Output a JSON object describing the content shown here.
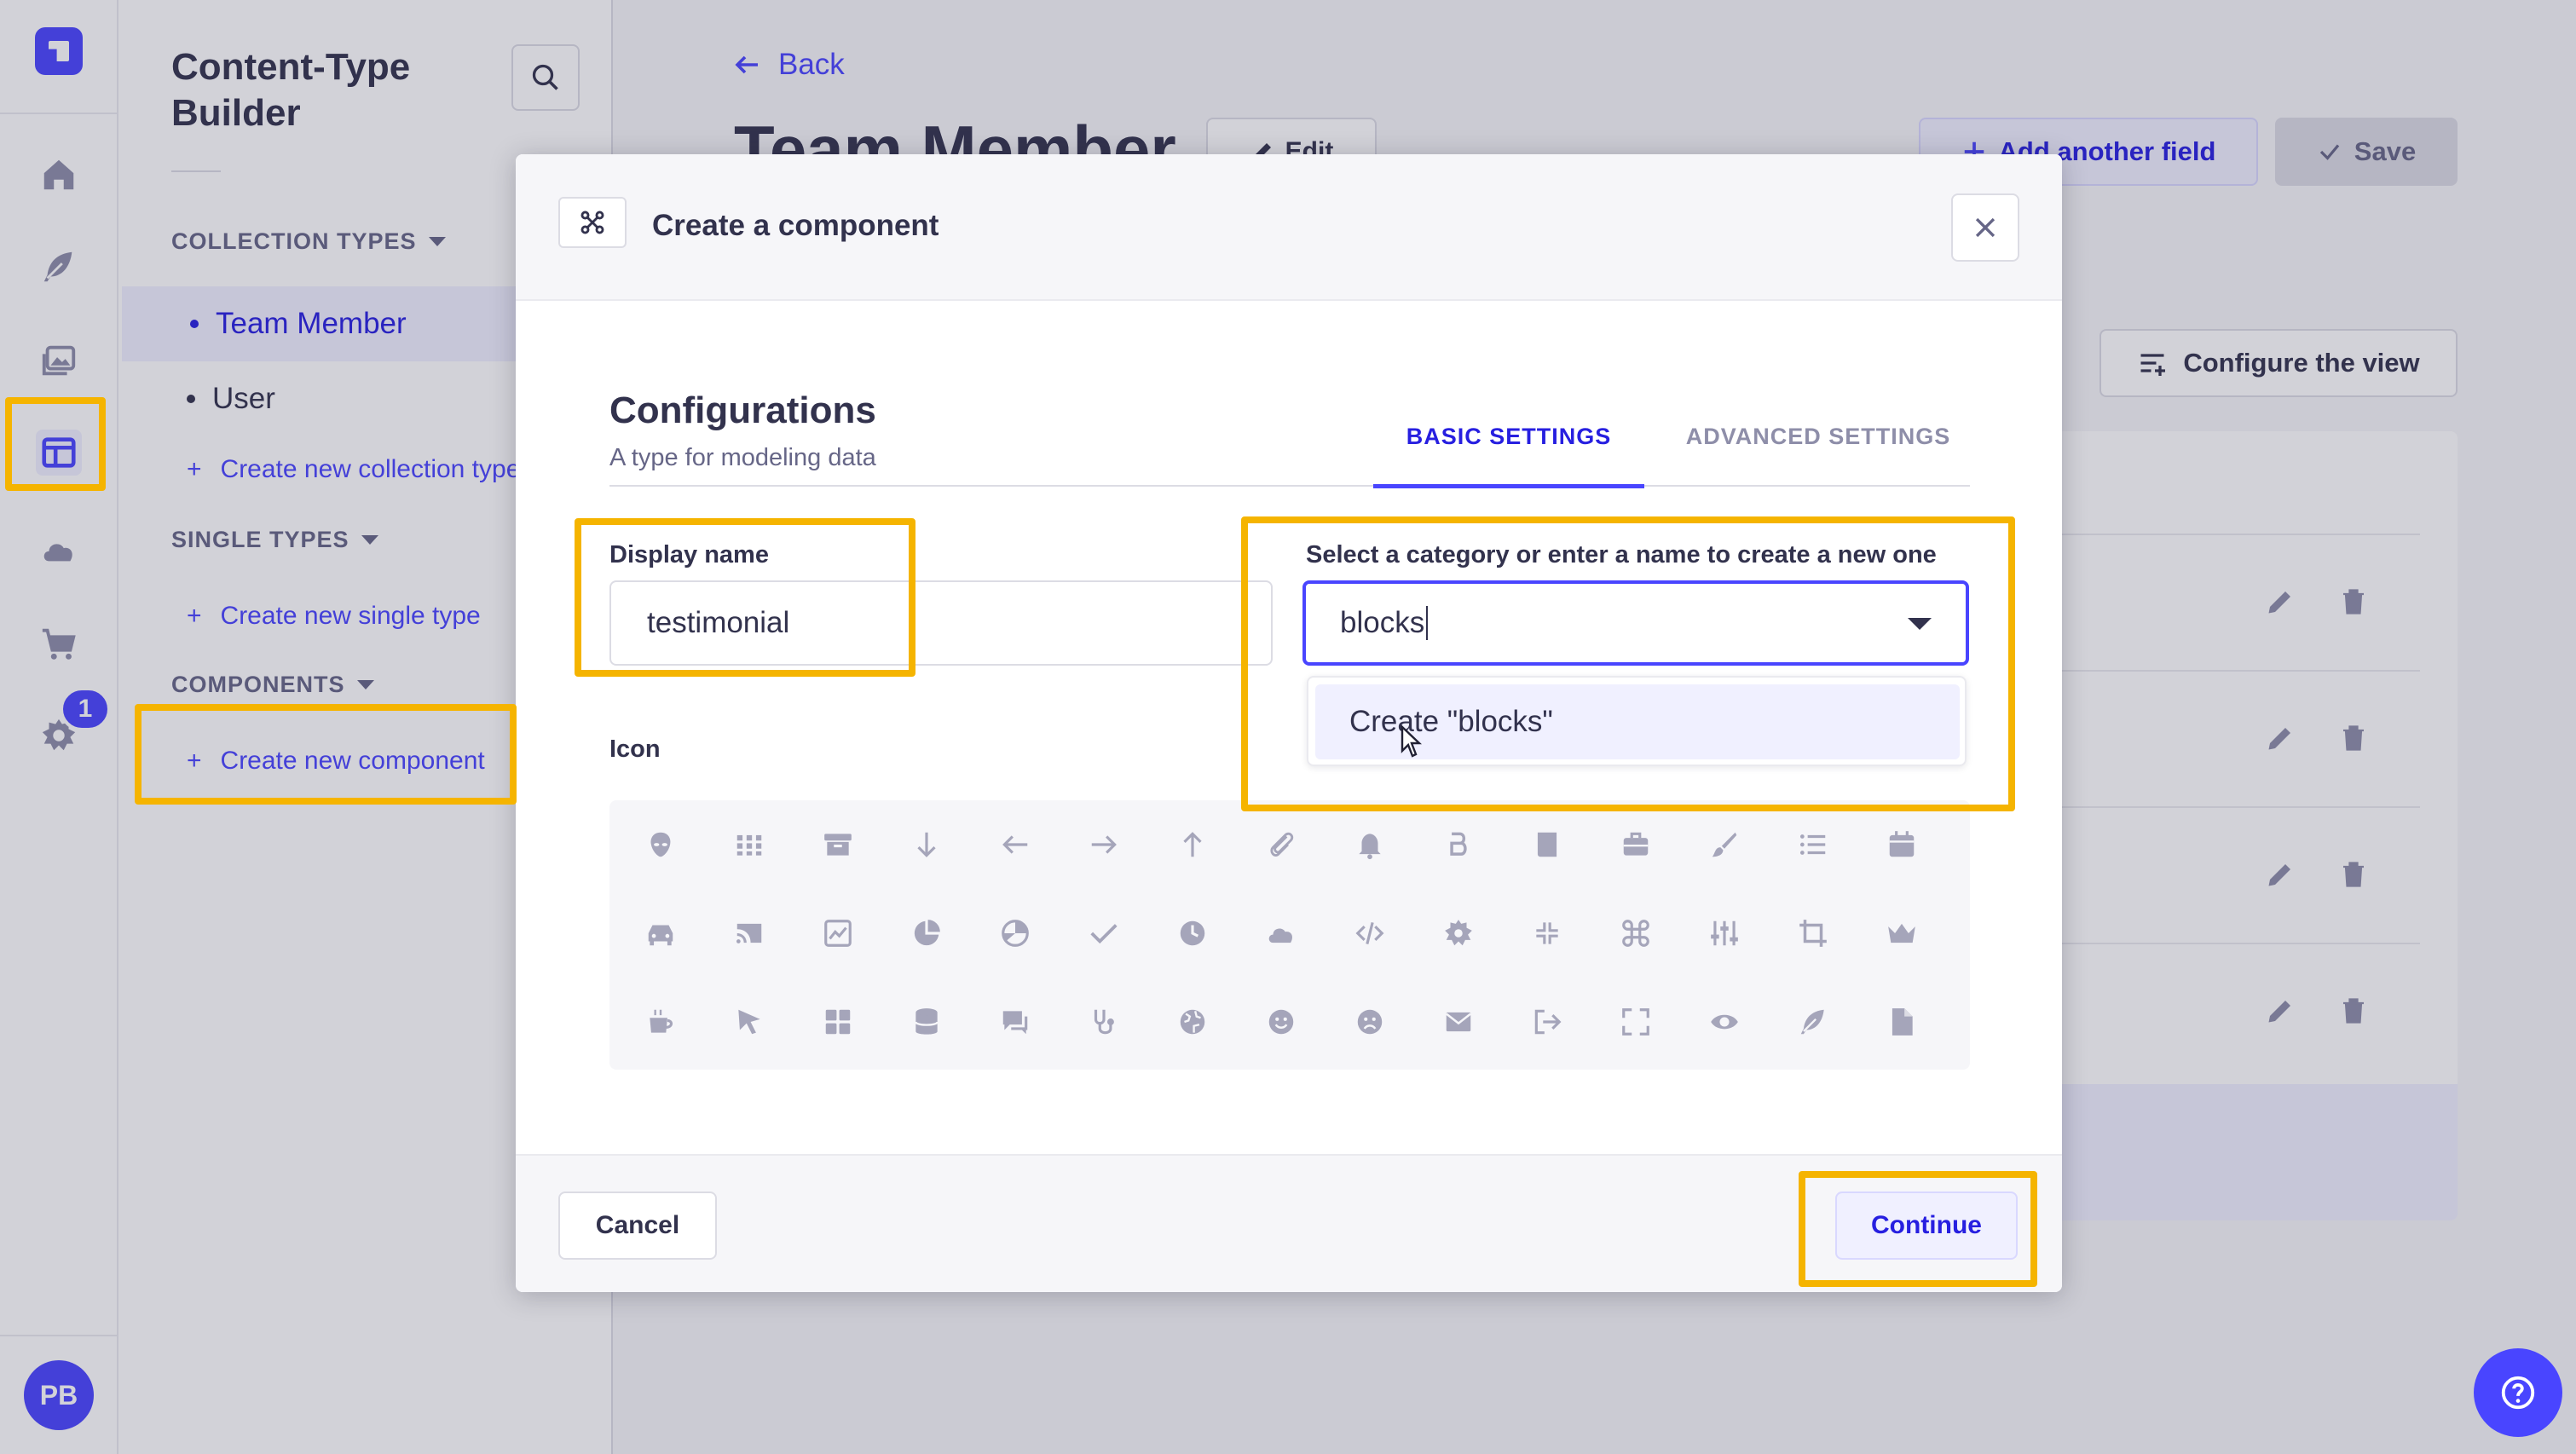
{
  "colors": {
    "primary": "#4945ff",
    "primary_dark": "#271fe0",
    "primary_light": "#f0f0ff",
    "highlight": "#f5b400",
    "text": "#32324d",
    "muted": "#666687"
  },
  "rail": {
    "icons": [
      "logo-icon",
      "home-icon",
      "feather-icon",
      "media-library-icon",
      "content-type-builder-icon",
      "cloud-icon",
      "cart-icon",
      "gear-icon"
    ],
    "settings_badge": "1",
    "avatar_initials": "PB"
  },
  "subnav": {
    "title": "Content-Type Builder",
    "collection_types": {
      "heading": "COLLECTION TYPES",
      "items": [
        {
          "label": "Team Member",
          "active": true
        },
        {
          "label": "User",
          "active": false
        }
      ],
      "create_label": "Create new collection type"
    },
    "single_types": {
      "heading": "SINGLE TYPES",
      "create_label": "Create new single type"
    },
    "components": {
      "heading": "COMPONENTS",
      "create_label": "Create new component"
    }
  },
  "main": {
    "back_label": "Back",
    "page_title": "Team Member",
    "edit_label": "Edit",
    "add_field_label": "Add another field",
    "save_label": "Save",
    "configure_view_label": "Configure the view"
  },
  "modal": {
    "title": "Create a component",
    "configurations_title": "Configurations",
    "configurations_subtitle": "A type for modeling data",
    "tabs": [
      {
        "label": "BASIC SETTINGS",
        "active": true
      },
      {
        "label": "ADVANCED SETTINGS",
        "active": false
      }
    ],
    "display_name": {
      "label": "Display name",
      "value": "testimonial"
    },
    "category": {
      "label": "Select a category or enter a name to create a new one",
      "value": "blocks",
      "option": "Create \"blocks\""
    },
    "icon_label": "Icon",
    "icons": [
      "alien-icon",
      "grid-icon",
      "archive-icon",
      "arrow-down-icon",
      "arrow-left-icon",
      "arrow-right-icon",
      "arrow-up-icon",
      "paperclip-icon",
      "bell-icon",
      "bold-icon",
      "book-icon",
      "briefcase-icon",
      "brush-icon",
      "bullet-list-icon",
      "calendar-icon",
      "car-icon",
      "cast-icon",
      "chart-box-icon",
      "chart-circle-icon",
      "chart-pie-icon",
      "check-icon",
      "clock-icon",
      "cloud-icon",
      "code-icon",
      "cog-icon",
      "collapse-icon",
      "command-icon",
      "sliders-icon",
      "crop-icon",
      "crown-icon",
      "coffee-icon",
      "cursor-icon",
      "dashboard-icon",
      "database-icon",
      "discuss-icon",
      "stethoscope-icon",
      "earth-icon",
      "smile-icon",
      "sad-icon",
      "envelope-icon",
      "exit-icon",
      "expand-icon",
      "eye-icon",
      "feather-icon",
      "file-icon"
    ],
    "cancel_label": "Cancel",
    "continue_label": "Continue"
  }
}
